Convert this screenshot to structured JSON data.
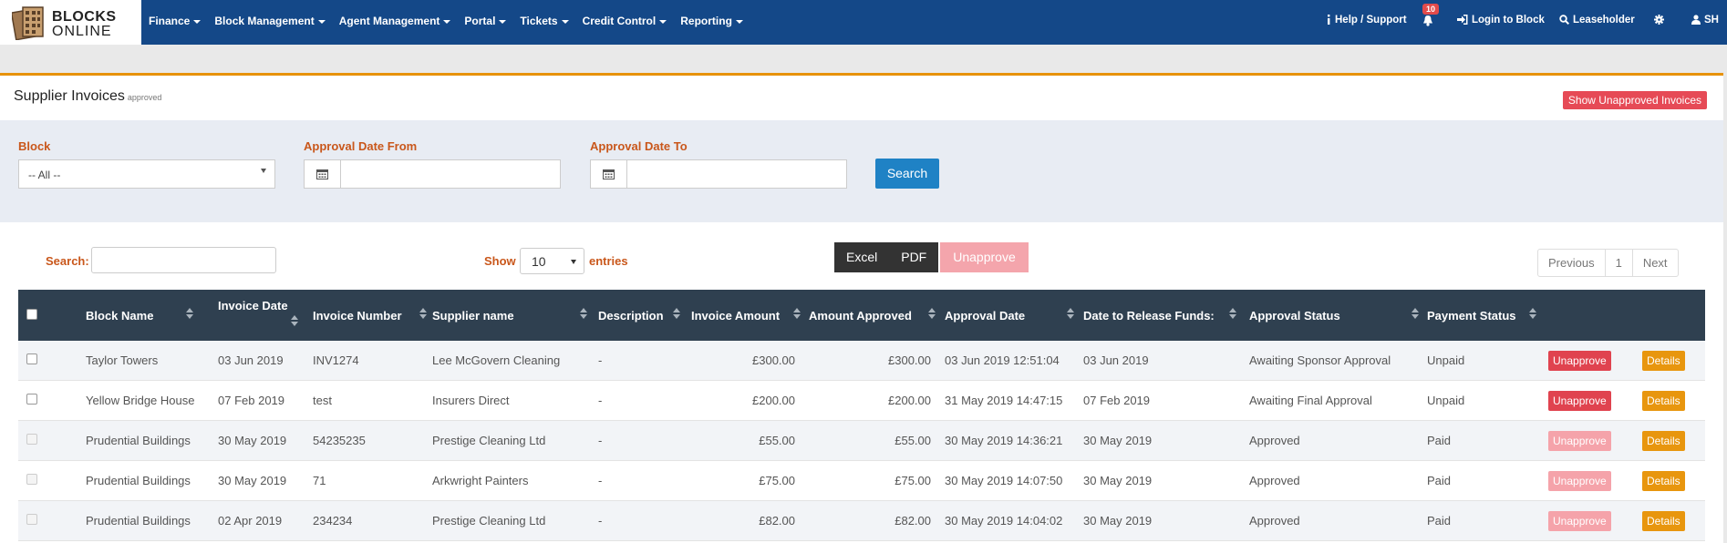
{
  "brand": {
    "line1": "BLOCKS",
    "line2": "ONLINE"
  },
  "nav": [
    {
      "label": "Finance"
    },
    {
      "label": "Block Management"
    },
    {
      "label": "Agent Management"
    },
    {
      "label": "Portal"
    },
    {
      "label": "Tickets"
    },
    {
      "label": "Credit Control"
    },
    {
      "label": "Reporting"
    }
  ],
  "right_nav": {
    "help": "Help / Support",
    "notifications_count": "10",
    "login": "Login to Block",
    "search": "Leaseholder",
    "user": "SH"
  },
  "page": {
    "title": "Supplier Invoices",
    "subtitle": "approved",
    "show_unapproved": "Show Unapproved Invoices"
  },
  "filters": {
    "block_label": "Block",
    "block_value": "-- All --",
    "from_label": "Approval Date From",
    "to_label": "Approval Date To",
    "search_button": "Search"
  },
  "table_controls": {
    "search_label": "Search:",
    "show_label": "Show",
    "entries_value": "10",
    "entries_label": "entries",
    "excel": "Excel",
    "pdf": "PDF",
    "unapprove": "Unapprove",
    "previous": "Previous",
    "page": "1",
    "next": "Next"
  },
  "columns": [
    "Block Name",
    "Invoice Date",
    "Invoice Number",
    "Supplier name",
    "Description",
    "Invoice Amount",
    "Amount Approved",
    "Approval Date",
    "Date to Release Funds:",
    "Approval Status",
    "Payment Status"
  ],
  "rows": [
    {
      "block": "Taylor Towers",
      "inv_date": "03 Jun 2019",
      "inv_no": "INV1274",
      "supplier": "Lee McGovern Cleaning",
      "desc": "-",
      "amount": "£300.00",
      "approved": "£300.00",
      "appr_date": "03 Jun 2019 12:51:04",
      "release": "03 Jun 2019",
      "status": "Awaiting Sponsor Approval",
      "payment": "Unpaid",
      "unapprove": "Unapprove",
      "details": "Details"
    },
    {
      "block": "Yellow Bridge House",
      "inv_date": "07 Feb 2019",
      "inv_no": "test",
      "supplier": "Insurers Direct",
      "desc": "-",
      "amount": "£200.00",
      "approved": "£200.00",
      "appr_date": "31 May 2019 14:47:15",
      "release": "07 Feb 2019",
      "status": "Awaiting Final Approval",
      "payment": "Unpaid",
      "unapprove": "Unapprove",
      "details": "Details"
    },
    {
      "block": "Prudential Buildings",
      "inv_date": "30 May 2019",
      "inv_no": "54235235",
      "supplier": "Prestige Cleaning Ltd",
      "desc": "-",
      "amount": "£55.00",
      "approved": "£55.00",
      "appr_date": "30 May 2019 14:36:21",
      "release": "30 May 2019",
      "status": "Approved",
      "payment": "Paid",
      "unapprove": "Unapprove",
      "details": "Details"
    },
    {
      "block": "Prudential Buildings",
      "inv_date": "30 May 2019",
      "inv_no": "71",
      "supplier": "Arkwright Painters",
      "desc": "-",
      "amount": "£75.00",
      "approved": "£75.00",
      "appr_date": "30 May 2019 14:07:50",
      "release": "30 May 2019",
      "status": "Approved",
      "payment": "Paid",
      "unapprove": "Unapprove",
      "details": "Details"
    },
    {
      "block": "Prudential Buildings",
      "inv_date": "02 Apr 2019",
      "inv_no": "234234",
      "supplier": "Prestige Cleaning Ltd",
      "desc": "-",
      "amount": "£82.00",
      "approved": "£82.00",
      "appr_date": "30 May 2019 14:04:02",
      "release": "30 May 2019",
      "status": "Approved",
      "payment": "Paid",
      "unapprove": "Unapprove",
      "details": "Details"
    }
  ],
  "colors": {
    "topbar": "#144888",
    "accent": "#e7920a",
    "label": "#c9571b",
    "danger": "#e0434f",
    "warning": "#e8960e",
    "primary": "#1f82c5",
    "table_head": "#2f4050"
  }
}
